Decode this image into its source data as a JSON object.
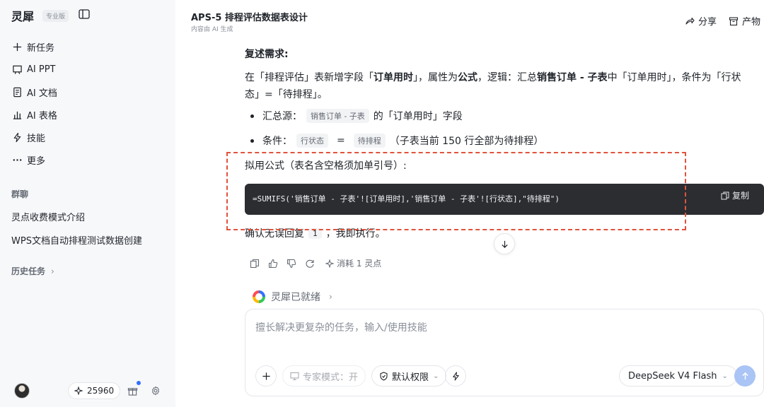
{
  "sidebar": {
    "brand": "灵犀",
    "badge": "专业版",
    "nav": [
      {
        "label": "新任务",
        "icon": "plus-icon"
      },
      {
        "label": "AI PPT",
        "icon": "presentation-icon"
      },
      {
        "label": "AI 文档",
        "icon": "document-icon"
      },
      {
        "label": "AI 表格",
        "icon": "chart-icon"
      },
      {
        "label": "技能",
        "icon": "lightning-icon"
      },
      {
        "label": "更多",
        "icon": "more-icon"
      }
    ],
    "group_title": "群聊",
    "groups": [
      "灵点收费模式介绍",
      "WPS文档自动排程测试数据创建"
    ],
    "history_title": "历史任务",
    "points": "25960"
  },
  "header": {
    "title": "APS-5 排程评估数据表设计",
    "subtitle": "内容由 AI 生成",
    "share": "分享",
    "product": "产物"
  },
  "message": {
    "heading": "复述需求:",
    "para_1": "在「排程评估」表新增字段「",
    "para_field": "订单用时",
    "para_2": "」，属性为",
    "para_attr": "公式",
    "para_3": "，逻辑：汇总",
    "para_src": "销售订单 - 子表",
    "para_4": "中「订单用时」，条件为「行状态」=「待排程」。",
    "bullet1_label": "汇总源：",
    "bullet1_chip": "销售订单 - 子表",
    "bullet1_tail": "的「订单用时」字段",
    "bullet2_label": "条件：",
    "bullet2_chip1": "行状态",
    "bullet2_eq": "=",
    "bullet2_chip2": "待排程",
    "bullet2_tail": "（子表当前 150 行全部为待排程）",
    "formula_label": "拟用公式（表名含空格须加单引号）:",
    "formula": "=SUMIFS('销售订单 - 子表'![订单用时],'销售订单 - 子表'![行状态],\"待排程\")",
    "copy": "复制",
    "confirm_1": "确认无误回复",
    "confirm_chip": "1",
    "confirm_2": "，我即执行。",
    "consume": "消耗 1 灵点"
  },
  "status": {
    "text": "灵犀已就绪"
  },
  "composer": {
    "placeholder": "擅长解决更复杂的任务，输入/使用技能",
    "expert_mode": "专家模式：开",
    "permission": "默认权限",
    "model": "DeepSeek V4 Flash"
  },
  "colors": {
    "annotation": "#e0533c",
    "code_bg": "#2b2d31",
    "send_button": "#a9c4f5"
  }
}
